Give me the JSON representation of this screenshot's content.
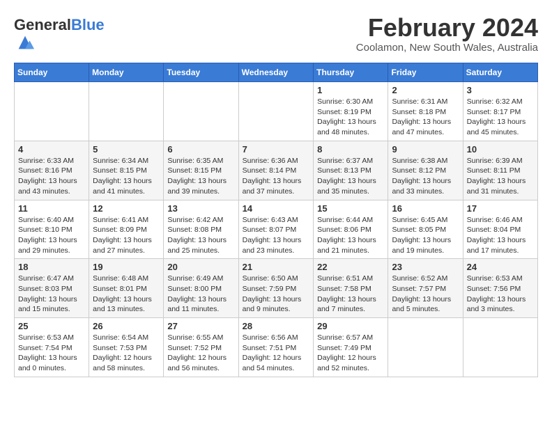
{
  "logo": {
    "general": "General",
    "blue": "Blue"
  },
  "title": "February 2024",
  "location": "Coolamon, New South Wales, Australia",
  "days_of_week": [
    "Sunday",
    "Monday",
    "Tuesday",
    "Wednesday",
    "Thursday",
    "Friday",
    "Saturday"
  ],
  "weeks": [
    [
      {
        "day": "",
        "info": ""
      },
      {
        "day": "",
        "info": ""
      },
      {
        "day": "",
        "info": ""
      },
      {
        "day": "",
        "info": ""
      },
      {
        "day": "1",
        "info": "Sunrise: 6:30 AM\nSunset: 8:19 PM\nDaylight: 13 hours and 48 minutes."
      },
      {
        "day": "2",
        "info": "Sunrise: 6:31 AM\nSunset: 8:18 PM\nDaylight: 13 hours and 47 minutes."
      },
      {
        "day": "3",
        "info": "Sunrise: 6:32 AM\nSunset: 8:17 PM\nDaylight: 13 hours and 45 minutes."
      }
    ],
    [
      {
        "day": "4",
        "info": "Sunrise: 6:33 AM\nSunset: 8:16 PM\nDaylight: 13 hours and 43 minutes."
      },
      {
        "day": "5",
        "info": "Sunrise: 6:34 AM\nSunset: 8:15 PM\nDaylight: 13 hours and 41 minutes."
      },
      {
        "day": "6",
        "info": "Sunrise: 6:35 AM\nSunset: 8:15 PM\nDaylight: 13 hours and 39 minutes."
      },
      {
        "day": "7",
        "info": "Sunrise: 6:36 AM\nSunset: 8:14 PM\nDaylight: 13 hours and 37 minutes."
      },
      {
        "day": "8",
        "info": "Sunrise: 6:37 AM\nSunset: 8:13 PM\nDaylight: 13 hours and 35 minutes."
      },
      {
        "day": "9",
        "info": "Sunrise: 6:38 AM\nSunset: 8:12 PM\nDaylight: 13 hours and 33 minutes."
      },
      {
        "day": "10",
        "info": "Sunrise: 6:39 AM\nSunset: 8:11 PM\nDaylight: 13 hours and 31 minutes."
      }
    ],
    [
      {
        "day": "11",
        "info": "Sunrise: 6:40 AM\nSunset: 8:10 PM\nDaylight: 13 hours and 29 minutes."
      },
      {
        "day": "12",
        "info": "Sunrise: 6:41 AM\nSunset: 8:09 PM\nDaylight: 13 hours and 27 minutes."
      },
      {
        "day": "13",
        "info": "Sunrise: 6:42 AM\nSunset: 8:08 PM\nDaylight: 13 hours and 25 minutes."
      },
      {
        "day": "14",
        "info": "Sunrise: 6:43 AM\nSunset: 8:07 PM\nDaylight: 13 hours and 23 minutes."
      },
      {
        "day": "15",
        "info": "Sunrise: 6:44 AM\nSunset: 8:06 PM\nDaylight: 13 hours and 21 minutes."
      },
      {
        "day": "16",
        "info": "Sunrise: 6:45 AM\nSunset: 8:05 PM\nDaylight: 13 hours and 19 minutes."
      },
      {
        "day": "17",
        "info": "Sunrise: 6:46 AM\nSunset: 8:04 PM\nDaylight: 13 hours and 17 minutes."
      }
    ],
    [
      {
        "day": "18",
        "info": "Sunrise: 6:47 AM\nSunset: 8:03 PM\nDaylight: 13 hours and 15 minutes."
      },
      {
        "day": "19",
        "info": "Sunrise: 6:48 AM\nSunset: 8:01 PM\nDaylight: 13 hours and 13 minutes."
      },
      {
        "day": "20",
        "info": "Sunrise: 6:49 AM\nSunset: 8:00 PM\nDaylight: 13 hours and 11 minutes."
      },
      {
        "day": "21",
        "info": "Sunrise: 6:50 AM\nSunset: 7:59 PM\nDaylight: 13 hours and 9 minutes."
      },
      {
        "day": "22",
        "info": "Sunrise: 6:51 AM\nSunset: 7:58 PM\nDaylight: 13 hours and 7 minutes."
      },
      {
        "day": "23",
        "info": "Sunrise: 6:52 AM\nSunset: 7:57 PM\nDaylight: 13 hours and 5 minutes."
      },
      {
        "day": "24",
        "info": "Sunrise: 6:53 AM\nSunset: 7:56 PM\nDaylight: 13 hours and 3 minutes."
      }
    ],
    [
      {
        "day": "25",
        "info": "Sunrise: 6:53 AM\nSunset: 7:54 PM\nDaylight: 13 hours and 0 minutes."
      },
      {
        "day": "26",
        "info": "Sunrise: 6:54 AM\nSunset: 7:53 PM\nDaylight: 12 hours and 58 minutes."
      },
      {
        "day": "27",
        "info": "Sunrise: 6:55 AM\nSunset: 7:52 PM\nDaylight: 12 hours and 56 minutes."
      },
      {
        "day": "28",
        "info": "Sunrise: 6:56 AM\nSunset: 7:51 PM\nDaylight: 12 hours and 54 minutes."
      },
      {
        "day": "29",
        "info": "Sunrise: 6:57 AM\nSunset: 7:49 PM\nDaylight: 12 hours and 52 minutes."
      },
      {
        "day": "",
        "info": ""
      },
      {
        "day": "",
        "info": ""
      }
    ]
  ]
}
